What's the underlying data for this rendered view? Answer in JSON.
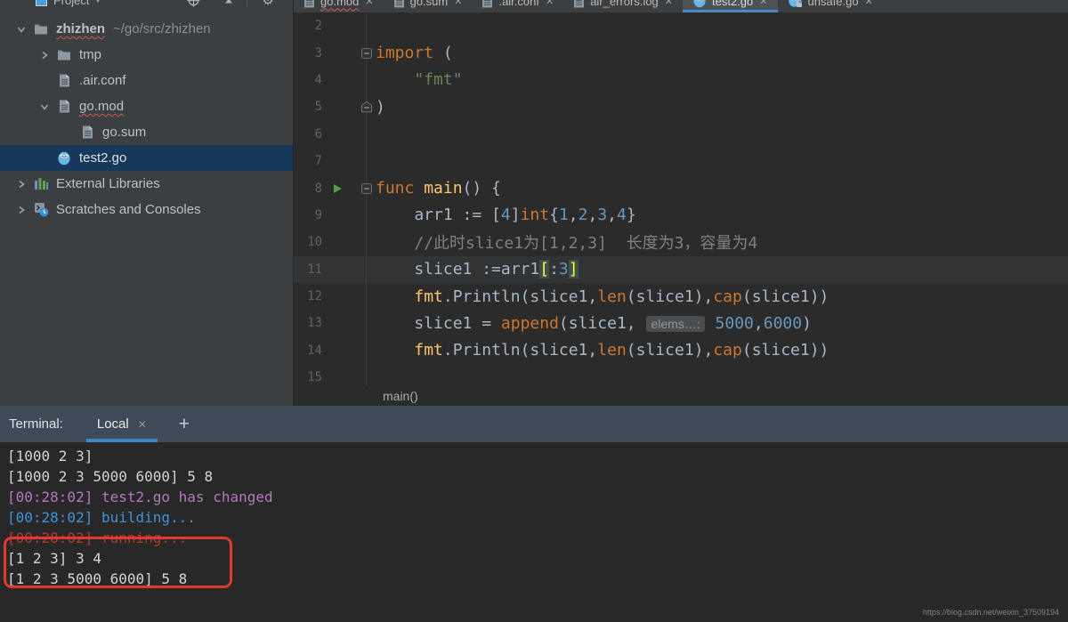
{
  "colors": {
    "accent": "#4a88c7",
    "kw": "#cc7832",
    "fn": "#ffc66d",
    "num": "#6897bb",
    "str": "#6a8759",
    "cm": "#808080",
    "pl": "#a9b7c6",
    "red": "#e0392f",
    "t_purple": "#b478be",
    "t_blue": "#4193d5",
    "t_red": "#b33a30",
    "selection_bg": "#16395b",
    "panel_bg": "#3c3f41",
    "editor_bg": "#2b2b2b",
    "terminal_header_bg": "#3e4a57"
  },
  "project_panel": {
    "title": "Project",
    "tree": [
      {
        "label": "zhizhen",
        "hint": "~/go/src/zhizhen",
        "icon": "folder",
        "chevron": "down",
        "level": 0,
        "error": true
      },
      {
        "label": "tmp",
        "icon": "folder",
        "chevron": "right",
        "level": 1
      },
      {
        "label": ".air.conf",
        "icon": "file",
        "chevron": null,
        "level": 1
      },
      {
        "label": "go.mod",
        "icon": "file",
        "chevron": "down",
        "level": 1,
        "error": true
      },
      {
        "label": "go.sum",
        "icon": "file",
        "chevron": null,
        "level": 2
      },
      {
        "label": "test2.go",
        "icon": "go",
        "chevron": null,
        "level": 1,
        "selected": true
      },
      {
        "label": "External Libraries",
        "icon": "libraries",
        "chevron": "right",
        "level": 0
      },
      {
        "label": "Scratches and Consoles",
        "icon": "scratches",
        "chevron": "right",
        "level": 0
      }
    ]
  },
  "tabs": [
    {
      "label": "go.mod",
      "icon": "file",
      "error": true
    },
    {
      "label": "go.sum",
      "icon": "file"
    },
    {
      "label": ".air.conf",
      "icon": "file"
    },
    {
      "label": "air_errors.log",
      "icon": "file"
    },
    {
      "label": "test2.go",
      "icon": "go",
      "active": true
    },
    {
      "label": "unsafe.go",
      "icon": "go-lock"
    }
  ],
  "editor": {
    "breadcrumb": "main()",
    "lines": [
      {
        "num": 2,
        "tokens": []
      },
      {
        "num": 3,
        "fold": "open",
        "tokens": [
          [
            "import",
            "kw"
          ],
          [
            " (",
            "pl"
          ]
        ]
      },
      {
        "num": 4,
        "tokens": [
          [
            "    ",
            "pl"
          ],
          [
            "\"fmt\"",
            "str"
          ]
        ]
      },
      {
        "num": 5,
        "fold": "close",
        "tokens": [
          [
            ")",
            "pl"
          ]
        ]
      },
      {
        "num": 6,
        "tokens": []
      },
      {
        "num": 7,
        "tokens": []
      },
      {
        "num": 8,
        "run": true,
        "fold": "open",
        "tokens": [
          [
            "func ",
            "kw"
          ],
          [
            "main",
            "fn"
          ],
          [
            "() {",
            "pl"
          ]
        ]
      },
      {
        "num": 9,
        "tokens": [
          [
            "    arr1 := [",
            "pl"
          ],
          [
            "4",
            "num"
          ],
          [
            "]",
            "pl"
          ],
          [
            "int",
            "kw"
          ],
          [
            "{",
            "pl"
          ],
          [
            "1",
            "num"
          ],
          [
            ",",
            "pl"
          ],
          [
            "2",
            "num"
          ],
          [
            ",",
            "pl"
          ],
          [
            "3",
            "num"
          ],
          [
            ",",
            "pl"
          ],
          [
            "4",
            "num"
          ],
          [
            "}",
            "pl"
          ]
        ]
      },
      {
        "num": 10,
        "tokens": [
          [
            "    ",
            "pl"
          ],
          [
            "//此时slice1为[1,2,3]  长度为3，容量为4",
            "cm"
          ]
        ]
      },
      {
        "num": 11,
        "current": true,
        "tokens": [
          [
            "    slice1 :=arr1",
            "pl"
          ],
          [
            "[",
            "br"
          ],
          [
            ":",
            "pl"
          ],
          [
            "3",
            "num"
          ],
          [
            "]",
            "br"
          ]
        ]
      },
      {
        "num": 12,
        "tokens": [
          [
            "    ",
            "pl"
          ],
          [
            "fmt",
            "fn"
          ],
          [
            ".",
            "pl"
          ],
          [
            "Println",
            "pl"
          ],
          [
            "(slice1,",
            "pl"
          ],
          [
            "len",
            "kw"
          ],
          [
            "(slice1),",
            "pl"
          ],
          [
            "cap",
            "kw"
          ],
          [
            "(slice1))",
            "pl"
          ]
        ]
      },
      {
        "num": 13,
        "tokens": [
          [
            "    slice1 = ",
            "pl"
          ],
          [
            "append",
            "kw"
          ],
          [
            "(slice1, ",
            "pl"
          ],
          [
            "elems…:",
            "hint"
          ],
          [
            " ",
            "pl"
          ],
          [
            "5000",
            "num"
          ],
          [
            ",",
            "pl"
          ],
          [
            "6000",
            "num"
          ],
          [
            ")",
            "pl"
          ]
        ]
      },
      {
        "num": 14,
        "tokens": [
          [
            "    ",
            "pl"
          ],
          [
            "fmt",
            "fn"
          ],
          [
            ".",
            "pl"
          ],
          [
            "Println",
            "pl"
          ],
          [
            "(slice1,",
            "pl"
          ],
          [
            "len",
            "kw"
          ],
          [
            "(slice1),",
            "pl"
          ],
          [
            "cap",
            "kw"
          ],
          [
            "(slice1))",
            "pl"
          ]
        ]
      },
      {
        "num": 15,
        "tokens": []
      }
    ]
  },
  "terminal": {
    "label": "Terminal:",
    "tab_label": "Local",
    "lines": [
      {
        "text": "[1000 2 3]",
        "color": "white"
      },
      {
        "text": "[1000 2 3 5000 6000] 5 8",
        "color": "white"
      },
      {
        "text": "[00:28:02] test2.go has changed",
        "color": "purple"
      },
      {
        "text": "[00:28:02] building...",
        "color": "blue"
      },
      {
        "text": "[00:28:02] running...",
        "color": "red"
      },
      {
        "text": "[1 2 3] 3 4",
        "color": "white"
      },
      {
        "text": "[1 2 3 5000 6000] 5 8",
        "color": "white"
      }
    ]
  },
  "watermark": "https://blog.csdn.net/weixin_37509194"
}
